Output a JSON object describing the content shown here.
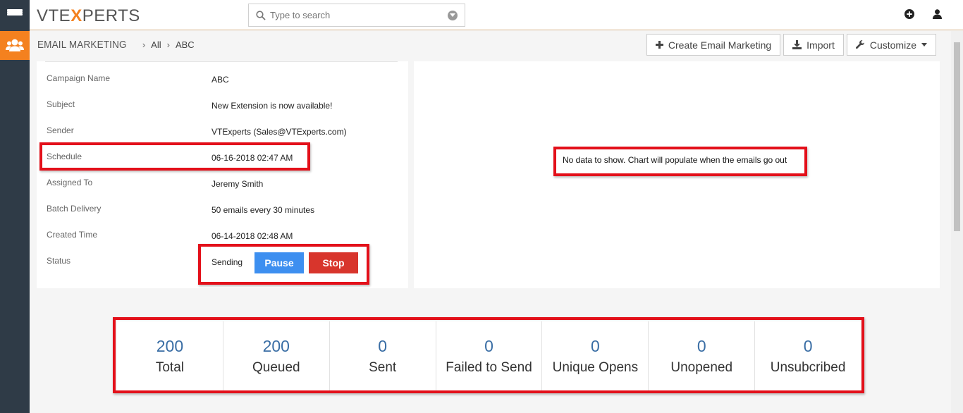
{
  "app": {
    "logo_prefix": "VTE",
    "logo_x": "X",
    "logo_suffix": "PERTS"
  },
  "search": {
    "placeholder": "Type to search"
  },
  "breadcrumb": {
    "module": "EMAIL MARKETING",
    "level1": "All",
    "level2": "ABC"
  },
  "toolbar": {
    "create_label": "Create Email Marketing",
    "import_label": "Import",
    "customize_label": "Customize"
  },
  "details": [
    {
      "label": "Campaign Name",
      "value": "ABC"
    },
    {
      "label": "Subject",
      "value": "New Extension is now available!"
    },
    {
      "label": "Sender",
      "value": "VTExperts (Sales@VTExperts.com)"
    },
    {
      "label": "Schedule",
      "value": "06-16-2018 02:47 AM"
    },
    {
      "label": "Assigned To",
      "value": "Jeremy Smith"
    },
    {
      "label": "Batch Delivery",
      "value": "50 emails every 30 minutes"
    },
    {
      "label": "Created Time",
      "value": "06-14-2018 02:48 AM"
    },
    {
      "label": "Status",
      "value": "Sending"
    }
  ],
  "status_actions": {
    "pause_label": "Pause",
    "stop_label": "Stop"
  },
  "chart_message": "No data to show. Chart will populate when the emails go out",
  "stats": [
    {
      "value": "200",
      "label": "Total"
    },
    {
      "value": "200",
      "label": "Queued"
    },
    {
      "value": "0",
      "label": "Sent"
    },
    {
      "value": "0",
      "label": "Failed to Send"
    },
    {
      "value": "0",
      "label": "Unique Opens"
    },
    {
      "value": "0",
      "label": "Unopened"
    },
    {
      "value": "0",
      "label": "Unsubcribed"
    }
  ],
  "colors": {
    "accent_orange": "#f4811f",
    "rail": "#2f3b47",
    "pause_button": "#3d8ff0",
    "stop_button": "#d8352c",
    "highlight_red": "#e3101a",
    "stat_number": "#3a6ea5"
  }
}
